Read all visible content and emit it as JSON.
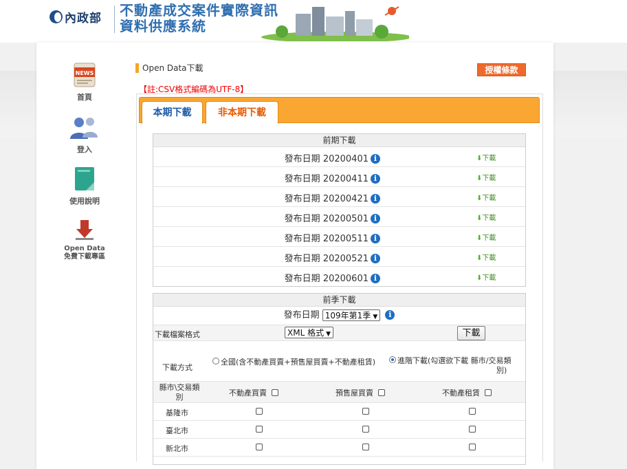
{
  "header": {
    "ministry": "內政部",
    "title_line1": "不動產成交案件實際資訊",
    "title_line2": "資料供應系統"
  },
  "sidebar": {
    "items": [
      {
        "label": "首頁",
        "badge": "NEWS"
      },
      {
        "label": "登入"
      },
      {
        "label": "使用說明"
      },
      {
        "label_line1": "Open Data",
        "label_line2": "免費下載專區"
      }
    ]
  },
  "page": {
    "breadcrumb": "Open Data下載",
    "license_button": "授權條款",
    "note": "【註:CSV格式編碼為UTF-8】"
  },
  "tabs": [
    {
      "label": "本期下載",
      "active": false
    },
    {
      "label": "非本期下載",
      "active": true
    }
  ],
  "previous_period": {
    "header": "前期下載",
    "date_prefix": "發布日期",
    "download_label": "下載",
    "rows": [
      {
        "date": "20200401"
      },
      {
        "date": "20200411"
      },
      {
        "date": "20200421"
      },
      {
        "date": "20200501"
      },
      {
        "date": "20200511"
      },
      {
        "date": "20200521"
      },
      {
        "date": "20200601"
      }
    ]
  },
  "previous_season": {
    "header": "前季下載",
    "date_label": "發布日期",
    "season_select": "109年第1季",
    "format_label": "下載檔案格式",
    "format_select": "XML 格式",
    "download_button": "下載",
    "method_label": "下載方式",
    "method_all": "全國(含不動產買賣+預售屋買賣+不動產租賃)",
    "method_advanced_line1": "進階下載(勾選欲下載 縣市/交易類",
    "method_advanced_line2": "別)",
    "method_selected": "advanced",
    "type_header_line1": "縣市\\交易類",
    "type_header_line2": "別",
    "columns": [
      "不動產買賣",
      "預售屋買賣",
      "不動產租賃"
    ],
    "cities": [
      "基隆市",
      "臺北市",
      "新北市"
    ]
  },
  "colors": {
    "accent_orange": "#f9a632",
    "license_button": "#ee6a2c",
    "note_red": "#e00000",
    "link_green": "#3d8a1e",
    "info_blue": "#1d6fc4"
  }
}
